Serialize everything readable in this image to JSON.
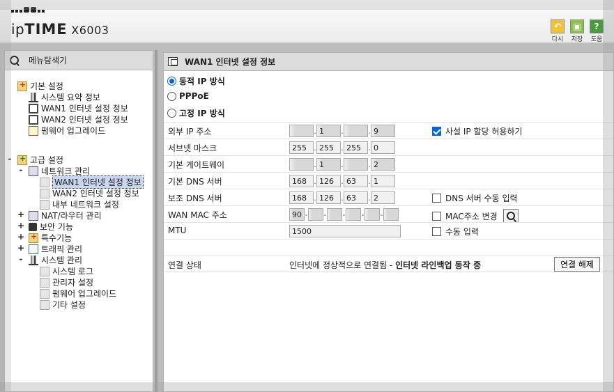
{
  "header": {
    "logo_prefix": "ip",
    "logo_brand": "TIME",
    "logo_model": " X6003",
    "buttons": [
      {
        "icon": "undo-icon",
        "label": "다시"
      },
      {
        "icon": "save-icon",
        "label": "저장"
      },
      {
        "icon": "help-icon",
        "label": "도움"
      }
    ]
  },
  "sidebar": {
    "title": "메뉴탐색기",
    "basic": {
      "label": "기본 설정",
      "items": [
        "시스템 요약 정보",
        "WAN1 인터넷 설정 정보",
        "WAN2 인터넷 설정 정보",
        "펌웨어 업그레이드"
      ]
    },
    "advanced": {
      "label": "고급 설정",
      "network": {
        "label": "네트워크 관리",
        "items": [
          "WAN1 인터넷 설정 정보",
          "WAN2 인터넷 설정 정보",
          "내부 네트워크 설정"
        ]
      },
      "nat": "NAT/라우터 관리",
      "security": "보안 기능",
      "special": "특수기능",
      "traffic": "트래픽 관리",
      "system": {
        "label": "시스템 관리",
        "items": [
          "시스템 로그",
          "관리자 설정",
          "펌웨어 업그레이드",
          "기타 설정"
        ]
      },
      "expand_symbols": {
        "minus": "-",
        "plus": "+"
      }
    }
  },
  "main": {
    "title": "WAN1 인터넷 설정 정보",
    "modes": [
      {
        "label": "동적 IP 방식",
        "selected": true
      },
      {
        "label": "PPPoE",
        "selected": false
      },
      {
        "label": "고정 IP 방식",
        "selected": false
      }
    ],
    "rows": {
      "external_ip": {
        "label": "외부 IP 주소",
        "values": [
          "",
          "1",
          "",
          "9"
        ]
      },
      "subnet": {
        "label": "서브넷 마스크",
        "values": [
          "255",
          "255",
          "255",
          "0"
        ]
      },
      "gateway": {
        "label": "기본 게이트웨이",
        "values": [
          "",
          "1",
          "",
          "2"
        ]
      },
      "dns1": {
        "label": "기본 DNS 서버",
        "values": [
          "168",
          "126",
          "63",
          "1"
        ]
      },
      "dns2": {
        "label": "보조 DNS 서버",
        "values": [
          "168",
          "126",
          "63",
          "2"
        ]
      },
      "wan_mac": {
        "label": "WAN MAC 주소",
        "values": [
          "90",
          "",
          "",
          "",
          "",
          ""
        ]
      },
      "mtu": {
        "label": "MTU",
        "value": "1500"
      }
    },
    "checks": {
      "private_ip": {
        "label": "사설 IP 할당 허용하기",
        "checked": true
      },
      "dns_manual": {
        "label": "DNS 서버 수동 입력",
        "checked": false
      },
      "mac_change": {
        "label": "MAC주소 변경",
        "checked": false
      },
      "mtu_manual": {
        "label": "수동 입력",
        "checked": false
      }
    },
    "status": {
      "label": "연결 상태",
      "text": "인터넷에 정상적으로 연결됨 - ",
      "bold": "인터넷 라인백업 동작 중",
      "button": "연결 해제"
    }
  }
}
